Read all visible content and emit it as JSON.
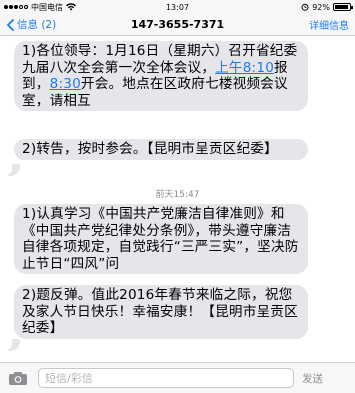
{
  "status_bar": {
    "carrier": "中国电信",
    "time": "13:07",
    "battery": "92%",
    "battery_level": 0.92
  },
  "nav": {
    "back_label": "信息 (2)",
    "title": "147-3655-7371",
    "details_label": "详细信息"
  },
  "messages": [
    {
      "before": "1)各位领导：1月16日（星期六）召开省纪委九届八次全会第一次全体会议，",
      "link1": "上午8:10",
      "mid": "报到，",
      "link2": "8:30",
      "after": "开会。地点在区政府七楼视频会议室，请相互"
    },
    {
      "text": "2)转告，按时参会。【昆明市呈贡区纪委】"
    },
    {
      "text": "1)认真学习《中国共产党廉洁自律准则》和《中国共产党纪律处分条例》，带头遵守廉洁自律各项规定，自觉践行“三严三实”，坚决防止节日“四风”问"
    },
    {
      "text": "2)题反弹。值此2016年春节来临之际，祝您及家人节日快乐！幸福安康！【昆明市呈贡区纪委】"
    }
  ],
  "timestamp": "前天15:47",
  "input": {
    "placeholder": "短信/彩信",
    "send_label": "发送"
  },
  "icons": {
    "back": "chevron-left-icon",
    "camera": "camera-icon",
    "wifi": "wifi-icon"
  },
  "colors": {
    "accent": "#1a7cf5",
    "bubble": "#e5e5ea"
  }
}
